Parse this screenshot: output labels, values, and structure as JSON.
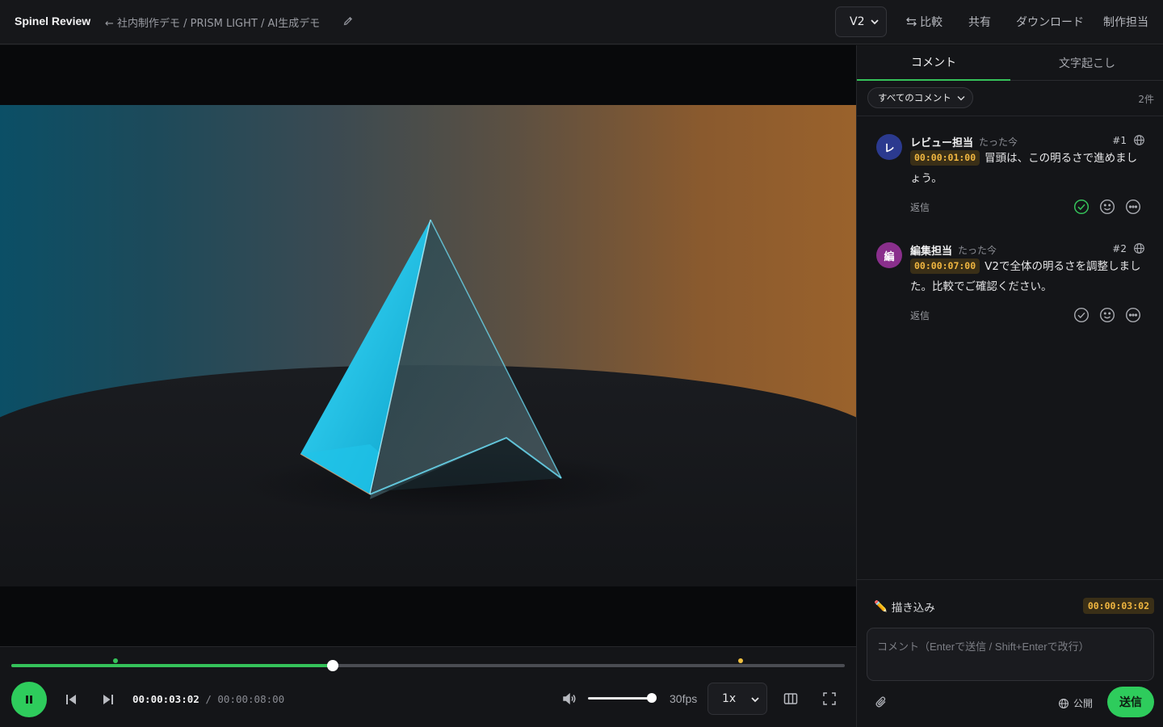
{
  "app": {
    "brand": "Spinel Review",
    "breadcrumb": "← 社内制作デモ / PRISM LIGHT / AI生成デモ"
  },
  "header": {
    "version": "V2",
    "compare_label": "比較",
    "share_label": "共有",
    "download_label": "ダウンロード",
    "user_label": "制作担当"
  },
  "player": {
    "current_time": "00:00:03:02",
    "separator": "/",
    "duration": "00:00:08:00",
    "progress_fraction": 0.3854,
    "volume_fraction": 1.0,
    "fps": "30fps",
    "speed": "1x",
    "colors": {
      "accent": "#2ecc5c",
      "marker_resolved": "#35c25a",
      "marker_open": "#f0c040"
    },
    "markers": [
      {
        "time": "00:00:01:00",
        "fraction": 0.125,
        "status": "resolved"
      },
      {
        "time": "00:00:07:00",
        "fraction": 0.875,
        "status": "open"
      }
    ]
  },
  "sidebar": {
    "tabs": [
      {
        "label": "コメント",
        "active": true
      },
      {
        "label": "文字起こし",
        "active": false
      }
    ],
    "filter": "すべてのコメント",
    "count": "2件",
    "comments": [
      {
        "avatar": "レ",
        "avatar_color": "#2b3a8f",
        "author": "レビュー担当",
        "time": "たった今",
        "number": "#1",
        "timecode": "00:00:01:00",
        "text": "冒頭は、この明るさで進めましょう。",
        "reply": "返信",
        "resolved": true
      },
      {
        "avatar": "編",
        "avatar_color": "#8a2f8c",
        "author": "編集担当",
        "time": "たった今",
        "number": "#2",
        "timecode": "00:00:07:00",
        "text": "V2で全体の明るさを調整しました。比較でご確認ください。",
        "reply": "返信",
        "resolved": false
      }
    ]
  },
  "composer": {
    "draw_label": "描き込み",
    "timecode": "00:00:03:02",
    "placeholder": "コメント（Enterで送信 / Shift+Enterで改行）",
    "visibility": "公開",
    "send_label": "送信"
  }
}
